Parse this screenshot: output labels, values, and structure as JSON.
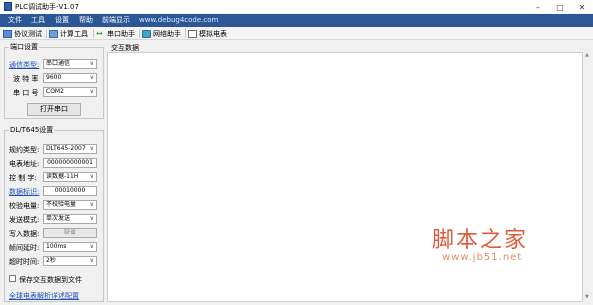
{
  "window": {
    "title": "PLC调试助手-V1.07"
  },
  "menu": {
    "items": [
      "文件",
      "工具",
      "设置",
      "帮助",
      "前端显示"
    ],
    "url": "www.debug4code.com"
  },
  "toolbar": {
    "items": [
      "协议测试",
      "计算工具",
      "串口助手",
      "网络助手",
      "模拟电表"
    ]
  },
  "serial_group": {
    "title": "端口设置",
    "type_label": "通信类型:",
    "type_value": "串口通信",
    "baud_label": "波 特 率",
    "baud_value": "9600",
    "port_label": "串 口 号",
    "port_value": "COM2",
    "open_button": "打开串口"
  },
  "dlt_group": {
    "title": "DL/T645设置",
    "protocol_label": "规约类型:",
    "protocol_value": "DLT645-2007",
    "address_label": "电表地址:",
    "address_value": "000000000001",
    "control_label": "控 制 字:",
    "control_value": "读数据-11H",
    "dataid_label": "数据标识:",
    "dataid_value": "00010000",
    "verify_label": "校验电量:",
    "verify_value": "不校验电量",
    "sendmode_label": "发送模式:",
    "sendmode_value": "单次发送",
    "write_label": "写入数据:",
    "write_value": "缺省",
    "interval_label": "帧间延时:",
    "interval_value": "100ms",
    "timeout_label": "超时时间:",
    "timeout_value": "2秒",
    "save_checkbox_label": "保存交互数据到文件",
    "bottom_link": "全球电表解析详述配置"
  },
  "data_panel": {
    "title": "交互数据"
  },
  "watermark": {
    "text_cn": "脚本之家",
    "text_url": "www.jb51.net"
  },
  "colors": {
    "menubar": "#2b5797",
    "link": "#1f4fbf",
    "watermark": "#e05a3a"
  }
}
